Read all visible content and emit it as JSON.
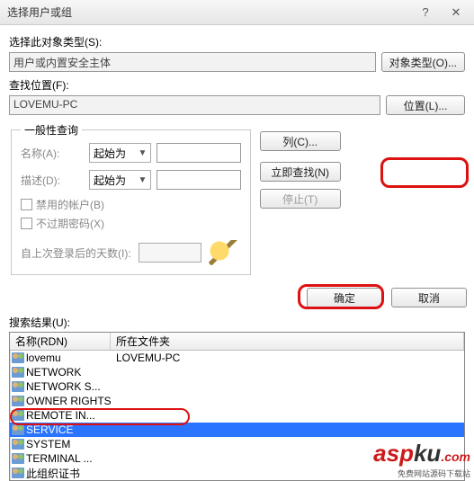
{
  "window": {
    "title": "选择用户或组"
  },
  "objectType": {
    "label": "选择此对象类型(S):",
    "value": "用户或内置安全主体",
    "button": "对象类型(O)..."
  },
  "location": {
    "label": "查找位置(F):",
    "value": "LOVEMU-PC",
    "button": "位置(L)..."
  },
  "query": {
    "group": "一般性查询",
    "name_label": "名称(A):",
    "name_combo": "起始为",
    "desc_label": "描述(D):",
    "desc_combo": "起始为",
    "cb_disabled": "禁用的帐户(B)",
    "cb_noexpire": "不过期密码(X)",
    "days_label": "自上次登录后的天数(I):"
  },
  "right_buttons": {
    "columns": "列(C)...",
    "find_now": "立即查找(N)",
    "stop": "停止(T)"
  },
  "actions": {
    "ok": "确定",
    "cancel": "取消"
  },
  "results": {
    "label": "搜索结果(U):",
    "col_name": "名称(RDN)",
    "col_folder": "所在文件夹",
    "rows": [
      {
        "name": "lovemu",
        "folder": "LOVEMU-PC"
      },
      {
        "name": "NETWORK",
        "folder": ""
      },
      {
        "name": "NETWORK S...",
        "folder": ""
      },
      {
        "name": "OWNER RIGHTS",
        "folder": ""
      },
      {
        "name": "REMOTE IN...",
        "folder": ""
      },
      {
        "name": "SERVICE",
        "folder": "",
        "selected": true
      },
      {
        "name": "SYSTEM",
        "folder": ""
      },
      {
        "name": "TERMINAL ...",
        "folder": ""
      },
      {
        "name": "此组织证书",
        "folder": ""
      }
    ]
  },
  "watermark": {
    "brand_a": "asp",
    "brand_b": "ku",
    "suffix": ".com",
    "sub": "免费网站源码下载站"
  }
}
